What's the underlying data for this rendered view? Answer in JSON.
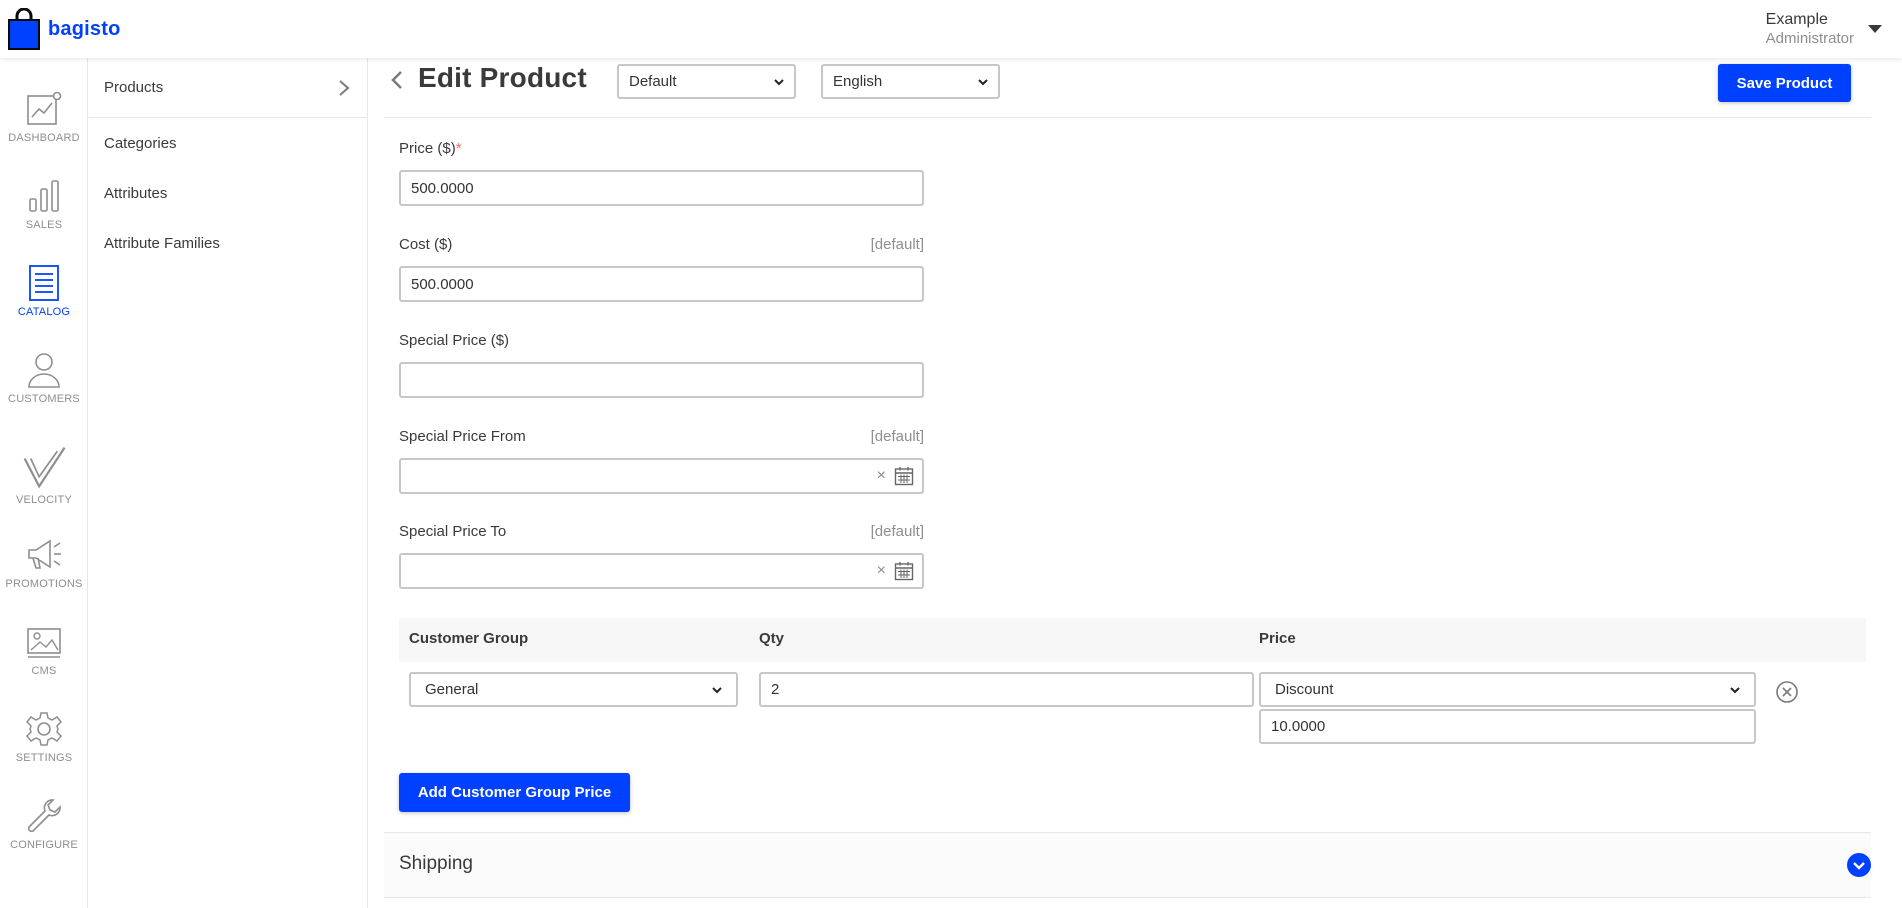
{
  "brand": {
    "name": "bagisto",
    "accent": "#0041ff"
  },
  "user": {
    "name": "Example",
    "role": "Administrator"
  },
  "rail": [
    {
      "label": "DASHBOARD",
      "icon": "dashboard-icon",
      "active": false
    },
    {
      "label": "SALES",
      "icon": "sales-icon",
      "active": false
    },
    {
      "label": "CATALOG",
      "icon": "catalog-icon",
      "active": true
    },
    {
      "label": "CUSTOMERS",
      "icon": "customers-icon",
      "active": false
    },
    {
      "label": "VELOCITY",
      "icon": "velocity-icon",
      "active": false
    },
    {
      "label": "PROMOTIONS",
      "icon": "promotions-icon",
      "active": false
    },
    {
      "label": "CMS",
      "icon": "cms-icon",
      "active": false
    },
    {
      "label": "SETTINGS",
      "icon": "settings-icon",
      "active": false
    },
    {
      "label": "CONFIGURE",
      "icon": "configure-icon",
      "active": false
    }
  ],
  "subnav": {
    "items": [
      {
        "label": "Products"
      },
      {
        "label": "Categories"
      },
      {
        "label": "Attributes"
      },
      {
        "label": "Attribute Families"
      }
    ]
  },
  "header": {
    "title": "Edit Product",
    "channel_select": "Default",
    "locale_select": "English",
    "save_label": "Save Product"
  },
  "form": {
    "price": {
      "label": "Price",
      "unit": "($)",
      "required_mark": "*",
      "value": "500.0000"
    },
    "cost": {
      "label": "Cost ($)",
      "scope": "[default]",
      "value": "500.0000"
    },
    "special_price": {
      "label": "Special Price",
      "unit": "($)",
      "value": ""
    },
    "special_price_from": {
      "label": "Special Price From",
      "scope": "[default]",
      "value": ""
    },
    "special_price_to": {
      "label": "Special Price To",
      "scope": "[default]",
      "value": ""
    }
  },
  "customer_group_price": {
    "headers": {
      "group": "Customer Group",
      "qty": "Qty",
      "price": "Price"
    },
    "rows": [
      {
        "group": "General",
        "qty": "2",
        "price_type": "Discount",
        "amount": "10.0000"
      }
    ],
    "add_label": "Add Customer Group Price"
  },
  "accordion": {
    "title": "Shipping"
  }
}
